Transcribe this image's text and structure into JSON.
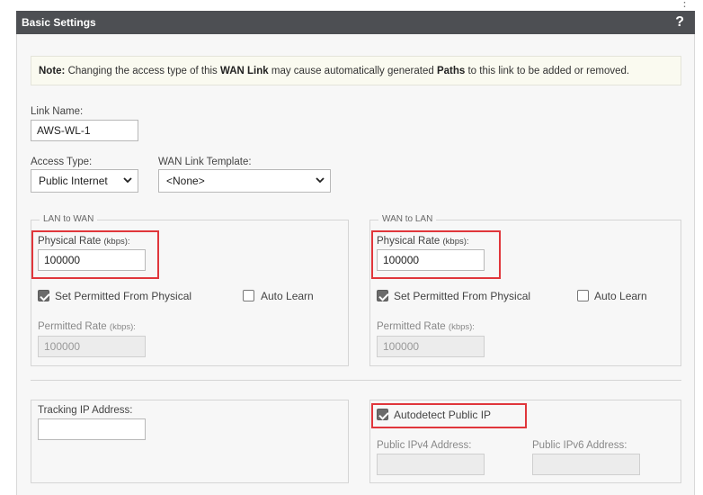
{
  "header": {
    "title": "Basic Settings",
    "help": "?",
    "menu": "⋮"
  },
  "note": {
    "prefix": "Note:",
    "t1": " Changing the access type of this ",
    "wan_link": "WAN Link",
    "t2": " may cause automatically generated ",
    "paths": "Paths",
    "t3": " to this link to be added or removed."
  },
  "link_name": {
    "label": "Link Name:",
    "value": "AWS-WL-1"
  },
  "access_type": {
    "label": "Access Type:",
    "value": "Public Internet"
  },
  "template": {
    "label": "WAN Link Template:",
    "value": "<None>"
  },
  "lan_to_wan": {
    "legend": "LAN to WAN",
    "physical_rate_label": "Physical Rate",
    "unit": "(kbps):",
    "physical_rate_value": "100000",
    "set_permitted_label": "Set Permitted From Physical",
    "set_permitted_checked": true,
    "auto_learn_label": "Auto Learn",
    "auto_learn_checked": false,
    "permitted_rate_label": "Permitted Rate",
    "permitted_rate_value": "100000"
  },
  "wan_to_lan": {
    "legend": "WAN to LAN",
    "physical_rate_label": "Physical Rate",
    "unit": "(kbps):",
    "physical_rate_value": "100000",
    "set_permitted_label": "Set Permitted From Physical",
    "set_permitted_checked": true,
    "auto_learn_label": "Auto Learn",
    "auto_learn_checked": false,
    "permitted_rate_label": "Permitted Rate",
    "permitted_rate_value": "100000"
  },
  "tracking": {
    "label": "Tracking IP Address:",
    "value": ""
  },
  "autodetect": {
    "label": "Autodetect Public IP",
    "checked": true,
    "ipv4_label": "Public IPv4 Address:",
    "ipv4_value": "",
    "ipv6_label": "Public IPv6 Address:",
    "ipv6_value": ""
  },
  "colors": {
    "header_bg": "#4d4f53",
    "highlight": "#e0363b",
    "panel_bg": "#f7f7f7"
  }
}
